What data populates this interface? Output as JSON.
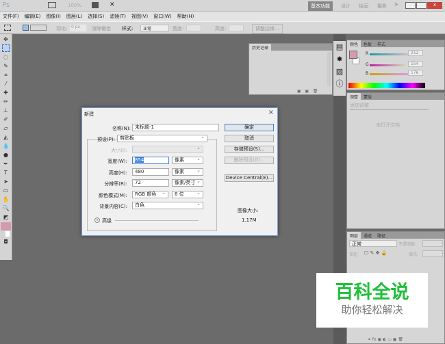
{
  "titlebar": {
    "logo": "Ps",
    "zoom": "100%",
    "workspaces": [
      "基本功能",
      "设计",
      "绘画",
      "摄影"
    ],
    "more": "»"
  },
  "menu": [
    "文件(F)",
    "编辑(E)",
    "图像(I)",
    "图层(L)",
    "选择(S)",
    "滤镜(T)",
    "视图(V)",
    "窗口(W)",
    "帮助(H)"
  ],
  "options": {
    "feather_label": "羽化:",
    "feather_value": "0 px",
    "antialias": "消除锯齿",
    "style_label": "样式:",
    "style_value": "正常",
    "width_label": "宽度:",
    "height_label": "高度:",
    "refine": "调整边缘..."
  },
  "history_panel": {
    "title": "历史记录"
  },
  "color_panel": {
    "tabs": [
      "颜色",
      "色板",
      "样式"
    ],
    "r_label": "R",
    "g_label": "G",
    "b_label": "B",
    "r": "212",
    "g": "154",
    "b": "176",
    "fg_color": "#d49ab0"
  },
  "adjust_panel": {
    "tabs": [
      "调整",
      "蒙版"
    ],
    "subtitle": "添加调整",
    "empty": "未打开文档"
  },
  "layers_panel": {
    "tabs": [
      "图层",
      "通道",
      "路径"
    ],
    "mode": "正常",
    "opacity_label": "不透明度:",
    "lock_label": "锁定:",
    "fill_label": "填充:"
  },
  "dialog": {
    "title": "新建",
    "close": "×",
    "name_label": "名称(N):",
    "name_value": "未标题-1",
    "preset_label": "预设(P):",
    "preset_value": "剪贴板",
    "size_label": "大小(I):",
    "width_label": "宽度(W):",
    "width_value": "854",
    "width_unit": "像素",
    "height_label": "高度(H):",
    "height_value": "480",
    "height_unit": "像素",
    "res_label": "分辨率(R):",
    "res_value": "72",
    "res_unit": "像素/英寸",
    "mode_label": "颜色模式(M):",
    "mode_value": "RGB 颜色",
    "depth_value": "8 位",
    "bg_label": "背景内容(C):",
    "bg_value": "白色",
    "advanced": "高级",
    "ok": "确定",
    "cancel": "取消",
    "save_preset": "存储预设(S)...",
    "delete_preset": "删除预设(D)...",
    "device_central": "Device Central(E)...",
    "image_size_label": "图像大小:",
    "image_size_value": "1.17M"
  },
  "watermark": {
    "title": "百科全说",
    "subtitle": "助你轻松解决"
  }
}
